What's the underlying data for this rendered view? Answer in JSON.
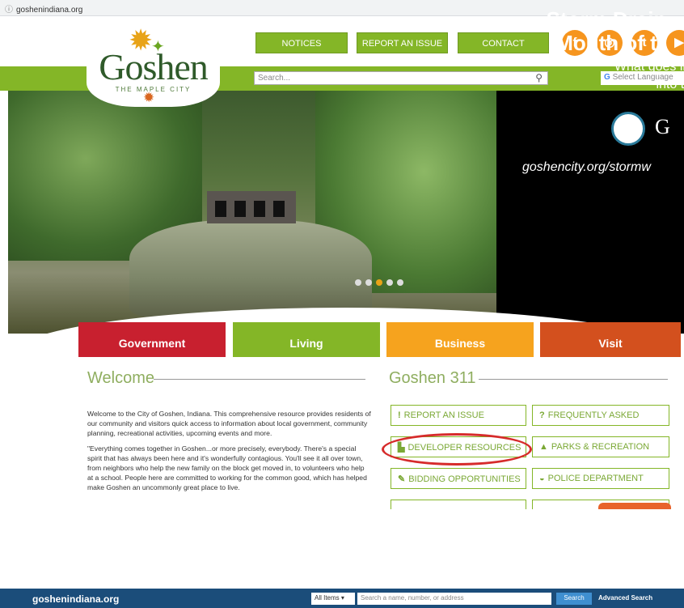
{
  "browser": {
    "url": "goshenindiana.org"
  },
  "header": {
    "logo_word": "Goshen",
    "logo_tagline": "THE MAPLE CITY",
    "nav": [
      "NOTICES",
      "REPORT AN ISSUE",
      "CONTACT"
    ],
    "social": [
      "f",
      "◎",
      "t",
      "▶"
    ],
    "search_placeholder": "Search...",
    "language": "Select Language"
  },
  "hero": {
    "title_line1": "Storm Drain",
    "title_line2": "Mouth of t",
    "sub_line1": "What goes into a",
    "sub_line2": "into the R",
    "brand_letter": "G",
    "url": "goshencity.org/stormw",
    "slide_dots": 5,
    "active_dot": 3
  },
  "tabs": [
    {
      "label": "Government",
      "color": "#c8202f"
    },
    {
      "label": "Living",
      "color": "#84b627"
    },
    {
      "label": "Business",
      "color": "#f6a31e"
    },
    {
      "label": "Visit",
      "color": "#d3501e"
    }
  ],
  "welcome": {
    "title": "Welcome",
    "para1": "Welcome to the City of Goshen, Indiana. This comprehensive resource provides residents of our community and visitors quick access to information about local government, community planning, recreational activities, upcoming events and more.",
    "para2": "\"Everything comes together in Goshen...or more precisely, everybody. There's a special spirit that has always been here and it's wonderfully contagious. You'll see it all over town, from neighbors who help the new family on the block get moved in, to volunteers who help at a school.  People here are committed to working for the common good, which has helped make Goshen an uncommonly great place to live."
  },
  "services": {
    "title": "Goshen 311",
    "items": [
      {
        "label": "REPORT AN ISSUE",
        "icon": "!"
      },
      {
        "label": "FREQUENTLY ASKED",
        "icon": "?"
      },
      {
        "label": "DEVELOPER RESOURCES",
        "icon": "▙"
      },
      {
        "label": "PARKS & RECREATION",
        "icon": "▲"
      },
      {
        "label": "BIDDING OPPORTUNITIES",
        "icon": "✎"
      },
      {
        "label": "POLICE DEPARTMENT",
        "icon": "◒"
      }
    ]
  },
  "bottombar": {
    "site": "goshenindiana.org",
    "select": "All Items ▾",
    "placeholder": "Search a name, number, or address",
    "search": "Search",
    "advanced": "Advanced Search"
  }
}
